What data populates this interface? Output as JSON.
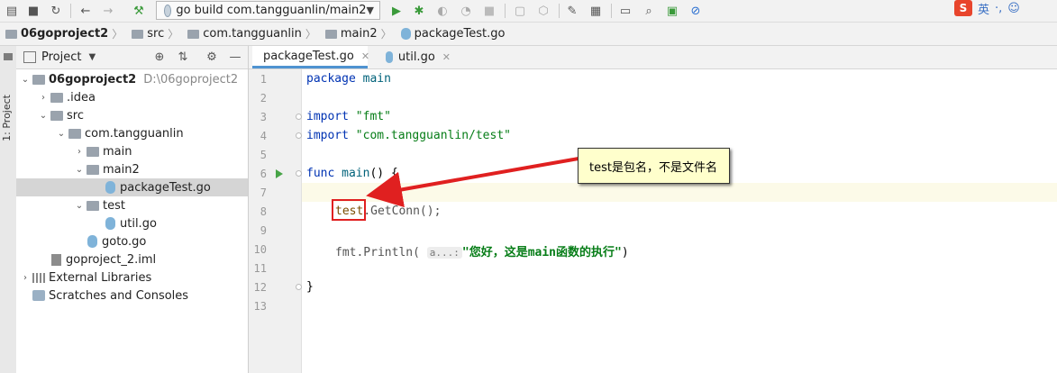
{
  "toolbar": {
    "run_config": "go build com.tangguanlin/main2",
    "ime_label": "英"
  },
  "breadcrumbs": [
    "06goproject2",
    "src",
    "com.tangguanlin",
    "main2",
    "packageTest.go"
  ],
  "sidebar_strip": {
    "label": "1: Project"
  },
  "project_panel": {
    "title": "Project",
    "tree": [
      {
        "label": "06goproject2",
        "path": "D:\\06goproject2",
        "level": 0,
        "kind": "folder",
        "expanded": true,
        "bold": true
      },
      {
        "label": ".idea",
        "level": 1,
        "kind": "folder",
        "expanded": false
      },
      {
        "label": "src",
        "level": 1,
        "kind": "folder",
        "expanded": true
      },
      {
        "label": "com.tangguanlin",
        "level": 2,
        "kind": "folder",
        "expanded": true
      },
      {
        "label": "main",
        "level": 3,
        "kind": "folder",
        "expanded": false
      },
      {
        "label": "main2",
        "level": 3,
        "kind": "folder",
        "expanded": true
      },
      {
        "label": "packageTest.go",
        "level": 4,
        "kind": "go",
        "selected": true
      },
      {
        "label": "test",
        "level": 3,
        "kind": "folder",
        "expanded": true
      },
      {
        "label": "util.go",
        "level": 4,
        "kind": "go"
      },
      {
        "label": "goto.go",
        "level": 3,
        "kind": "go"
      },
      {
        "label": "goproject_2.iml",
        "level": 1,
        "kind": "iml"
      },
      {
        "label": "External Libraries",
        "level": 0,
        "kind": "lib",
        "expanded": false
      },
      {
        "label": "Scratches and Consoles",
        "level": 0,
        "kind": "scratch"
      }
    ]
  },
  "tabs": [
    {
      "label": "packageTest.go",
      "active": true
    },
    {
      "label": "util.go",
      "active": false
    }
  ],
  "editor": {
    "line_numbers": [
      "1",
      "2",
      "3",
      "4",
      "5",
      "6",
      "7",
      "8",
      "9",
      "10",
      "11",
      "12",
      "13"
    ],
    "code": {
      "l1_kw": "package",
      "l1_name": " main",
      "l3_kw": "import",
      "l3_str": " \"fmt\"",
      "l4_kw": "import",
      "l4_str": " \"com.tangguanlin/test\"",
      "l6_kw": "func",
      "l6_name": " main",
      "l6_rest": "() {",
      "l8_pkg": "test",
      "l8_rest": ".GetConn();",
      "l10_pre": "fmt.Println(",
      "l10_hint": "a...:",
      "l10_str": "\"您好，这是main函数的执行\"",
      "l10_end": ")",
      "l12": "}"
    }
  },
  "annotation": {
    "callout_text": "test是包名，不是文件名",
    "color": "#e02020"
  }
}
